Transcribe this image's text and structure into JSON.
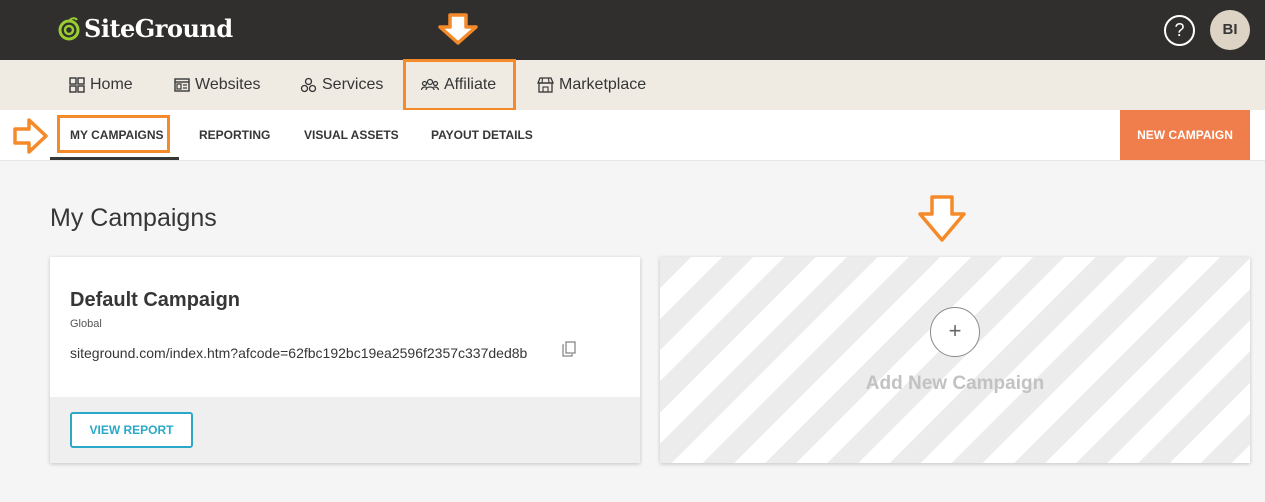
{
  "brand": {
    "name": "SiteGround",
    "accent": "#f07e4d",
    "highlight": "#f58a2a",
    "link": "#2ba8c8"
  },
  "topbar": {
    "help_label": "?",
    "avatar_initials": "BI"
  },
  "main_nav": {
    "items": [
      {
        "label": "Home",
        "icon": "grid-icon"
      },
      {
        "label": "Websites",
        "icon": "browser-icon"
      },
      {
        "label": "Services",
        "icon": "cubes-icon"
      },
      {
        "label": "Affiliate",
        "icon": "users-icon"
      },
      {
        "label": "Marketplace",
        "icon": "store-icon"
      }
    ],
    "active": "Affiliate"
  },
  "sub_nav": {
    "items": [
      {
        "label": "MY CAMPAIGNS"
      },
      {
        "label": "REPORTING"
      },
      {
        "label": "VISUAL ASSETS"
      },
      {
        "label": "PAYOUT DETAILS"
      }
    ],
    "active": "MY CAMPAIGNS",
    "new_campaign_label": "NEW CAMPAIGN"
  },
  "page": {
    "title": "My Campaigns"
  },
  "campaign": {
    "title": "Default Campaign",
    "region": "Global",
    "url": "siteground.com/index.htm?afcode=62fbc192bc19ea2596f2357c337ded8b",
    "view_report_label": "VIEW REPORT"
  },
  "add_campaign": {
    "plus": "+",
    "label": "Add New Campaign"
  }
}
